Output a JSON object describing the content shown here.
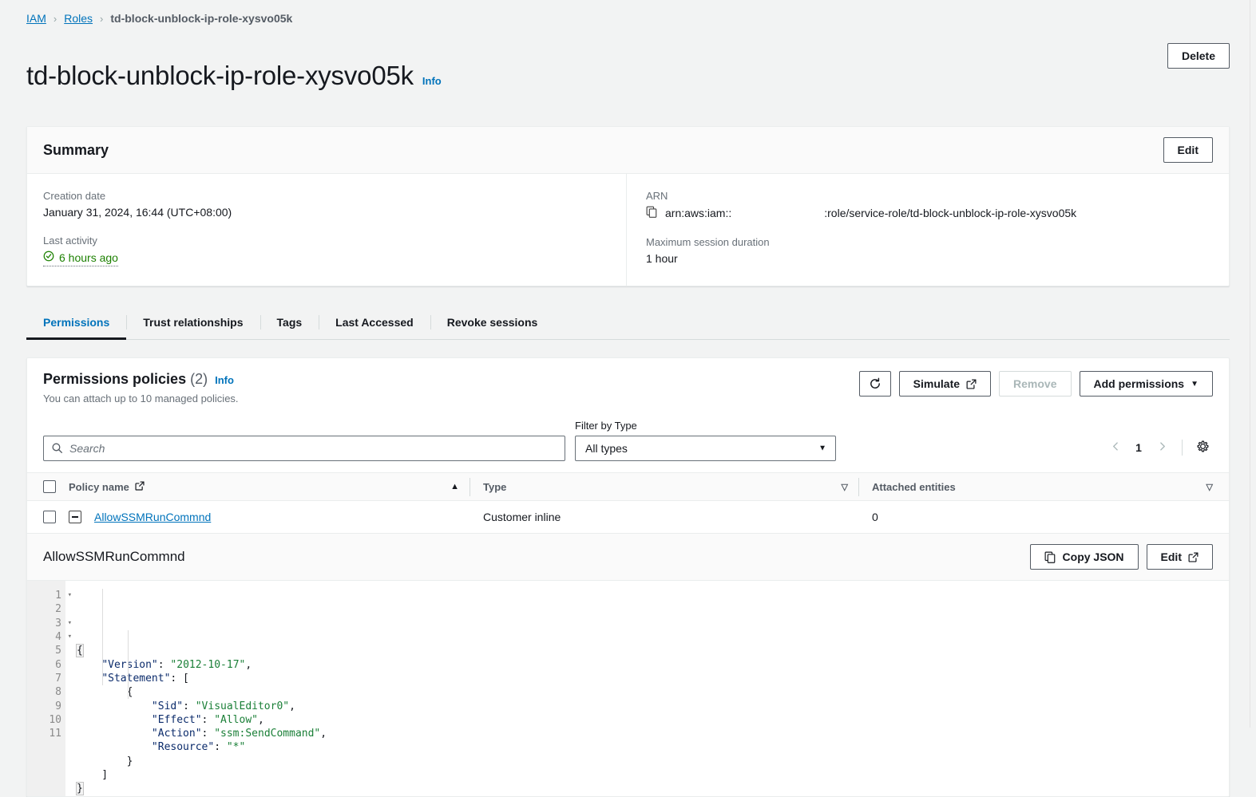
{
  "breadcrumb": {
    "items": [
      {
        "label": "IAM",
        "type": "link"
      },
      {
        "label": "Roles",
        "type": "link"
      },
      {
        "label": "td-block-unblock-ip-role-xysvo05k",
        "type": "current"
      }
    ],
    "separator": "›"
  },
  "header": {
    "title": "td-block-unblock-ip-role-xysvo05k",
    "info_label": "Info",
    "delete_label": "Delete"
  },
  "summary": {
    "heading": "Summary",
    "edit_label": "Edit",
    "creation_date_label": "Creation date",
    "creation_date_value": "January 31, 2024, 16:44 (UTC+08:00)",
    "last_activity_label": "Last activity",
    "last_activity_value": "6 hours ago",
    "arn_label": "ARN",
    "arn_prefix": "arn:aws:iam::",
    "arn_suffix": ":role/service-role/td-block-unblock-ip-role-xysvo05k",
    "max_session_label": "Maximum session duration",
    "max_session_value": "1 hour"
  },
  "tabs": [
    {
      "label": "Permissions",
      "active": true
    },
    {
      "label": "Trust relationships",
      "active": false
    },
    {
      "label": "Tags",
      "active": false
    },
    {
      "label": "Last Accessed",
      "active": false
    },
    {
      "label": "Revoke sessions",
      "active": false
    }
  ],
  "permissions": {
    "title": "Permissions policies",
    "count": "(2)",
    "info_label": "Info",
    "subtitle": "You can attach up to 10 managed policies.",
    "refresh_icon": "refresh-icon",
    "simulate_label": "Simulate",
    "remove_label": "Remove",
    "add_permissions_label": "Add permissions",
    "add_permissions_caret": "▼"
  },
  "filter": {
    "search_placeholder": "Search",
    "search_value": "",
    "filter_by_type_label": "Filter by Type",
    "type_selected": "All types",
    "type_caret": "▼",
    "page_number": "1",
    "prev_icon": "chevron-left-icon",
    "next_icon": "chevron-right-icon",
    "settings_icon": "gear-icon"
  },
  "table": {
    "columns": [
      {
        "label": "Policy name",
        "sort": "asc",
        "external_link": true
      },
      {
        "label": "Type",
        "sort": "none",
        "external_link": false
      },
      {
        "label": "Attached entities",
        "sort": "none",
        "external_link": false
      }
    ],
    "sort_asc_glyph": "▲",
    "sort_none_glyph": "▽",
    "rows": [
      {
        "policy_name": "AllowSSMRunCommnd",
        "type": "Customer inline",
        "attached_entities": "0",
        "expanded": true
      }
    ]
  },
  "policy_detail": {
    "title": "AllowSSMRunCommnd",
    "copy_json_label": "Copy JSON",
    "edit_label": "Edit",
    "code_lines": [
      {
        "num": "1",
        "fold": true,
        "tokens": [
          {
            "t": "p",
            "v": "{"
          }
        ]
      },
      {
        "num": "2",
        "fold": false,
        "tokens": [
          {
            "t": "p",
            "v": "    "
          },
          {
            "t": "k",
            "v": "\"Version\""
          },
          {
            "t": "p",
            "v": ": "
          },
          {
            "t": "s",
            "v": "\"2012-10-17\""
          },
          {
            "t": "p",
            "v": ","
          }
        ]
      },
      {
        "num": "3",
        "fold": true,
        "tokens": [
          {
            "t": "p",
            "v": "    "
          },
          {
            "t": "k",
            "v": "\"Statement\""
          },
          {
            "t": "p",
            "v": ": ["
          }
        ]
      },
      {
        "num": "4",
        "fold": true,
        "tokens": [
          {
            "t": "p",
            "v": "        {"
          }
        ]
      },
      {
        "num": "5",
        "fold": false,
        "tokens": [
          {
            "t": "p",
            "v": "            "
          },
          {
            "t": "k",
            "v": "\"Sid\""
          },
          {
            "t": "p",
            "v": ": "
          },
          {
            "t": "s",
            "v": "\"VisualEditor0\""
          },
          {
            "t": "p",
            "v": ","
          }
        ]
      },
      {
        "num": "6",
        "fold": false,
        "tokens": [
          {
            "t": "p",
            "v": "            "
          },
          {
            "t": "k",
            "v": "\"Effect\""
          },
          {
            "t": "p",
            "v": ": "
          },
          {
            "t": "s",
            "v": "\"Allow\""
          },
          {
            "t": "p",
            "v": ","
          }
        ]
      },
      {
        "num": "7",
        "fold": false,
        "tokens": [
          {
            "t": "p",
            "v": "            "
          },
          {
            "t": "k",
            "v": "\"Action\""
          },
          {
            "t": "p",
            "v": ": "
          },
          {
            "t": "s",
            "v": "\"ssm:SendCommand\""
          },
          {
            "t": "p",
            "v": ","
          }
        ]
      },
      {
        "num": "8",
        "fold": false,
        "tokens": [
          {
            "t": "p",
            "v": "            "
          },
          {
            "t": "k",
            "v": "\"Resource\""
          },
          {
            "t": "p",
            "v": ": "
          },
          {
            "t": "s",
            "v": "\"*\""
          }
        ]
      },
      {
        "num": "9",
        "fold": false,
        "tokens": [
          {
            "t": "p",
            "v": "        }"
          }
        ]
      },
      {
        "num": "10",
        "fold": false,
        "tokens": [
          {
            "t": "p",
            "v": "    ]"
          }
        ]
      },
      {
        "num": "11",
        "fold": false,
        "tokens": [
          {
            "t": "p",
            "v": "}"
          }
        ]
      }
    ],
    "fold_glyph": "▾"
  },
  "colors": {
    "link": "#0073bb",
    "page_bg": "#f2f3f3",
    "success": "#1d8102",
    "json_key": "#0b2b6b",
    "json_string": "#1a7f37",
    "border": "#eaeded"
  }
}
